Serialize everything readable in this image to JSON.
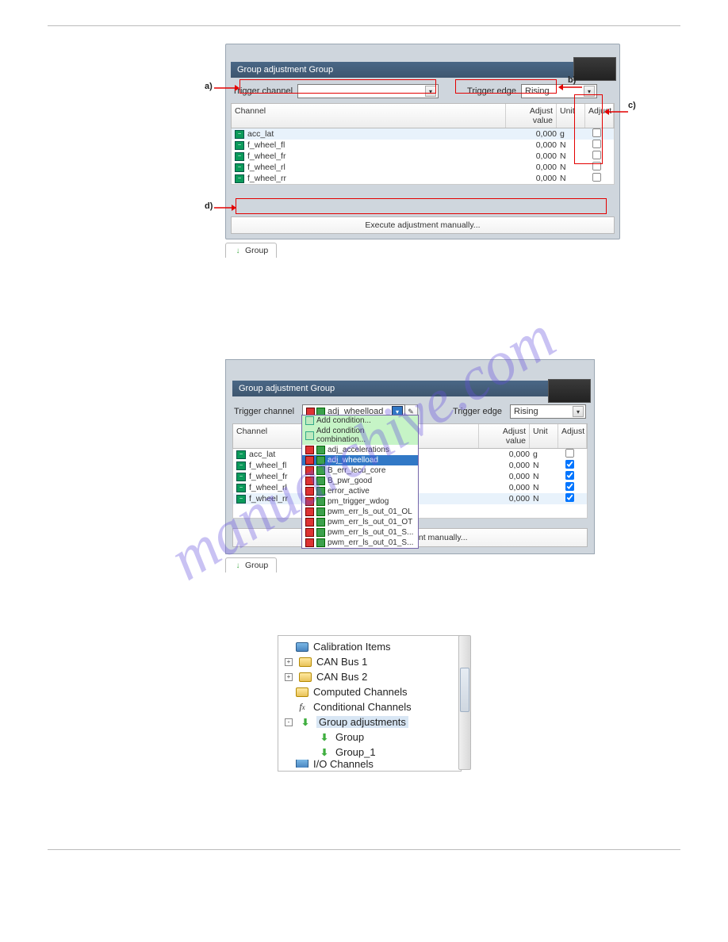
{
  "watermark": "manuarchive.com",
  "annotations": {
    "a": "a)",
    "b": "b)",
    "c": "c)",
    "d": "d)"
  },
  "fig1": {
    "title": "Group adjustment Group",
    "trigger_channel_label": "Trigger channel",
    "trigger_edge_label": "Trigger edge",
    "trigger_edge_value": "Rising",
    "columns": {
      "channel": "Channel",
      "adjust_value": "Adjust value",
      "unit": "Unit",
      "adjust": "Adjust"
    },
    "rows": [
      {
        "name": "acc_lat",
        "value": "0,000",
        "unit": "g"
      },
      {
        "name": "f_wheel_fl",
        "value": "0,000",
        "unit": "N"
      },
      {
        "name": "f_wheel_fr",
        "value": "0,000",
        "unit": "N"
      },
      {
        "name": "f_wheel_rl",
        "value": "0,000",
        "unit": "N"
      },
      {
        "name": "f_wheel_rr",
        "value": "0,000",
        "unit": "N"
      }
    ],
    "exec": "Execute adjustment manually...",
    "tab": "Group"
  },
  "fig2": {
    "title": "Group adjustment Group",
    "trigger_channel_label": "Trigger channel",
    "trigger_channel_value": "adj_wheelload",
    "trigger_edge_label": "Trigger edge",
    "trigger_edge_value": "Rising",
    "columns": {
      "channel": "Channel",
      "adjust_value": "Adjust value",
      "unit": "Unit",
      "adjust": "Adjust"
    },
    "rows": [
      {
        "name": "acc_lat",
        "value": "0,000",
        "unit": "g",
        "checked": false
      },
      {
        "name": "f_wheel_fl",
        "value": "0,000",
        "unit": "N",
        "checked": true
      },
      {
        "name": "f_wheel_fr",
        "value": "0,000",
        "unit": "N",
        "checked": true
      },
      {
        "name": "f_wheel_rl",
        "value": "0,000",
        "unit": "N",
        "checked": true
      },
      {
        "name": "f_wheel_rr",
        "value": "0,000",
        "unit": "N",
        "checked": true
      }
    ],
    "dropdown": {
      "add_cond": "Add condition...",
      "add_comb": "Add condition combination...",
      "items": [
        "adj_accelerations",
        "adj_wheelload",
        "B_err_lecu_core",
        "B_pwr_good",
        "error_active",
        "pm_trigger_wdog",
        "pwm_err_ls_out_01_OL",
        "pwm_err_ls_out_01_OT",
        "pwm_err_ls_out_01_S...",
        "pwm_err_ls_out_01_S..."
      ],
      "selected_index": 1
    },
    "exec": "Execute adjustment manually...",
    "tab": "Group"
  },
  "fig3": {
    "items": [
      {
        "label": "Calibration Items",
        "icon": "calib"
      },
      {
        "label": "CAN Bus 1",
        "icon": "folder",
        "expander": "+"
      },
      {
        "label": "CAN Bus 2",
        "icon": "folder",
        "expander": "+"
      },
      {
        "label": "Computed Channels",
        "icon": "folder"
      },
      {
        "label": "Conditional Channels",
        "icon": "fx"
      },
      {
        "label": "Group adjustments",
        "icon": "down",
        "expander": "-",
        "highlight": true
      },
      {
        "label": "Group",
        "icon": "down",
        "sub": true
      },
      {
        "label": "Group_1",
        "icon": "down",
        "sub": true
      },
      {
        "label": "I/O Channels",
        "icon": "calib",
        "cut": true
      }
    ]
  }
}
